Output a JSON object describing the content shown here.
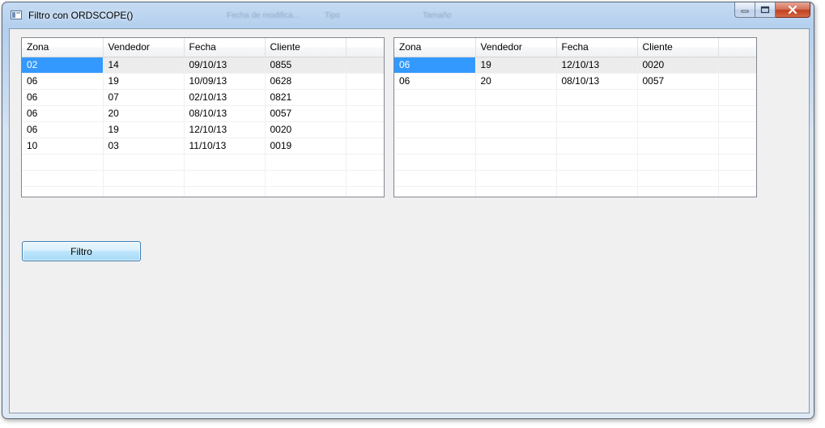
{
  "window": {
    "title": "Filtro con ORDSCOPE()",
    "ghost_headers": [
      "Fecha de modifica...",
      "Tipo",
      "Tamaño"
    ]
  },
  "left_grid": {
    "columns": [
      "Zona",
      "Vendedor",
      "Fecha",
      "Cliente"
    ],
    "rows": [
      [
        "02",
        "14",
        "09/10/13",
        "0855"
      ],
      [
        "06",
        "19",
        "10/09/13",
        "0628"
      ],
      [
        "06",
        "07",
        "02/10/13",
        "0821"
      ],
      [
        "06",
        "20",
        "08/10/13",
        "0057"
      ],
      [
        "06",
        "19",
        "12/10/13",
        "0020"
      ],
      [
        "10",
        "03",
        "11/10/13",
        "0019"
      ]
    ],
    "selected_row": 0
  },
  "right_grid": {
    "columns": [
      "Zona",
      "Vendedor",
      "Fecha",
      "Cliente"
    ],
    "rows": [
      [
        "06",
        "19",
        "12/10/13",
        "0020"
      ],
      [
        "06",
        "20",
        "08/10/13",
        "0057"
      ]
    ],
    "selected_row": 0
  },
  "filter_button": {
    "label": "Filtro"
  },
  "caption_buttons": [
    "minimize-icon",
    "maximize-icon",
    "close-icon"
  ],
  "colors": {
    "selection": "#3399ff",
    "row_highlight": "#ececec",
    "client_bg": "#f0f0f0"
  }
}
